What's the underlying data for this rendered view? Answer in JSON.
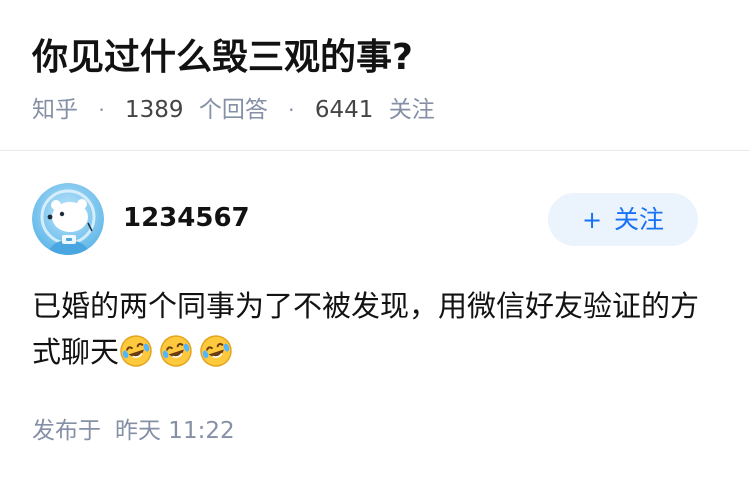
{
  "question": {
    "title": "你见过什么毁三观的事?",
    "source": "知乎",
    "answer_count": "1389",
    "answer_label": "个回答",
    "follower_count": "6441",
    "follower_label": "关注",
    "separator": "·"
  },
  "answer": {
    "author": "1234567",
    "avatar_icon": "polar-bear-avatar-icon",
    "follow_button": {
      "plus": "+",
      "label": "关注"
    },
    "content_text": "已婚的两个同事为了不被发现，用微信好友验证的方式聊天",
    "emoji_icon": "laughing-tears-emoji-icon",
    "emoji_count": 3,
    "posted_label": "发布于",
    "posted_time": "昨天 11:22"
  },
  "colors": {
    "primary": "#1772f6",
    "follow_bg": "#ebf3fd",
    "meta_gray": "#8590a6",
    "text": "#121212"
  }
}
